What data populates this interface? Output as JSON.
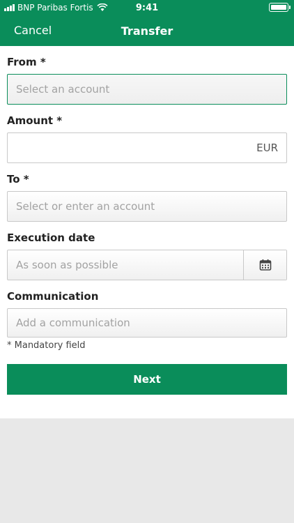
{
  "status": {
    "carrier": "BNP Paribas Fortis",
    "time": "9:41"
  },
  "nav": {
    "cancel": "Cancel",
    "title": "Transfer"
  },
  "form": {
    "from_label": "From *",
    "from_placeholder": "Select an account",
    "amount_label": "Amount *",
    "amount_currency": "EUR",
    "to_label": "To *",
    "to_placeholder": "Select or enter an account",
    "date_label": "Execution date",
    "date_placeholder": "As soon as possible",
    "comm_label": "Communication",
    "comm_placeholder": "Add a communication",
    "mandatory_note": "* Mandatory field",
    "next": "Next"
  },
  "colors": {
    "brand": "#0a8d5a"
  }
}
